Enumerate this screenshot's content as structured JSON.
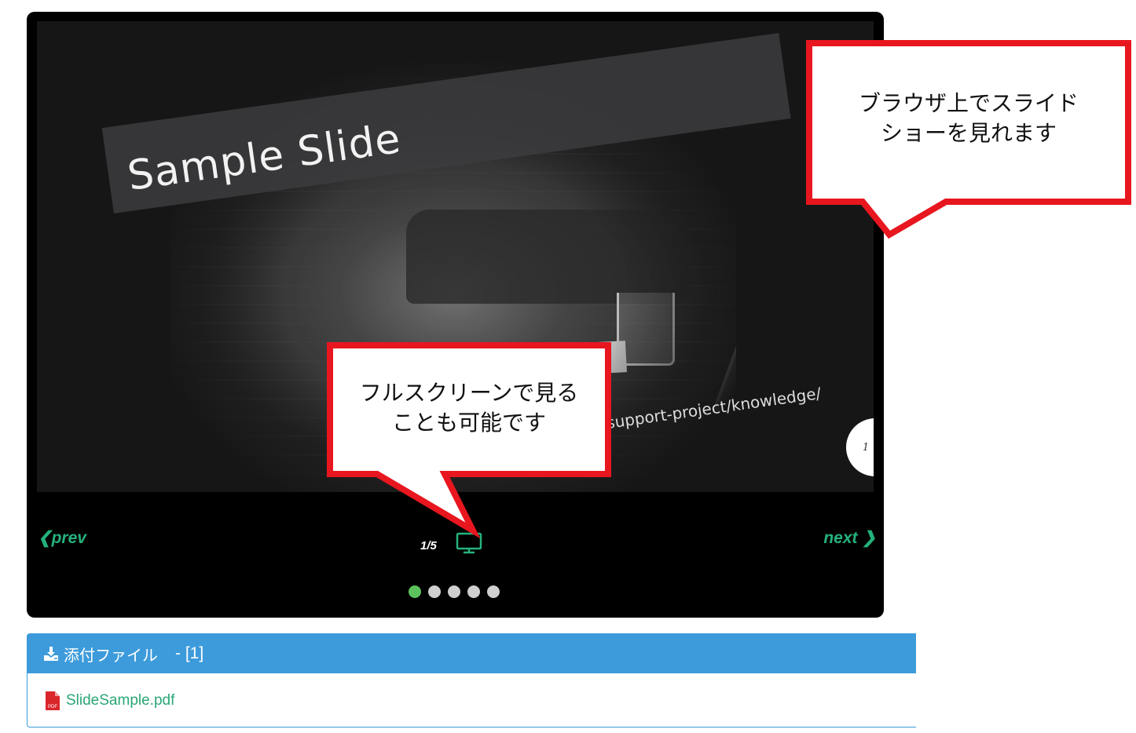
{
  "slideshow": {
    "slide_title": "Sample Slide",
    "slide_url": "support-project/knowledge/",
    "page_badge": "1",
    "prev_label": "prev",
    "next_label": "next",
    "counter": "1/5",
    "total_slides": 5,
    "active_slide_index": 0,
    "fullscreen_icon": "monitor-icon",
    "accent_color": "#24b27c"
  },
  "callouts": {
    "top_right": [
      "ブラウザ上でスライド",
      "ショーを見れます"
    ],
    "fullscreen": [
      "フルスクリーンで見る",
      "ことも可能です"
    ],
    "border_color": "#e8161f"
  },
  "attachments": {
    "title": "添付ファイル",
    "count": "- [1]",
    "header_icon": "download-icon",
    "header_color": "#3d9bdb",
    "files": [
      {
        "name": "SlideSample.pdf",
        "icon": "pdf-file-icon"
      }
    ]
  }
}
